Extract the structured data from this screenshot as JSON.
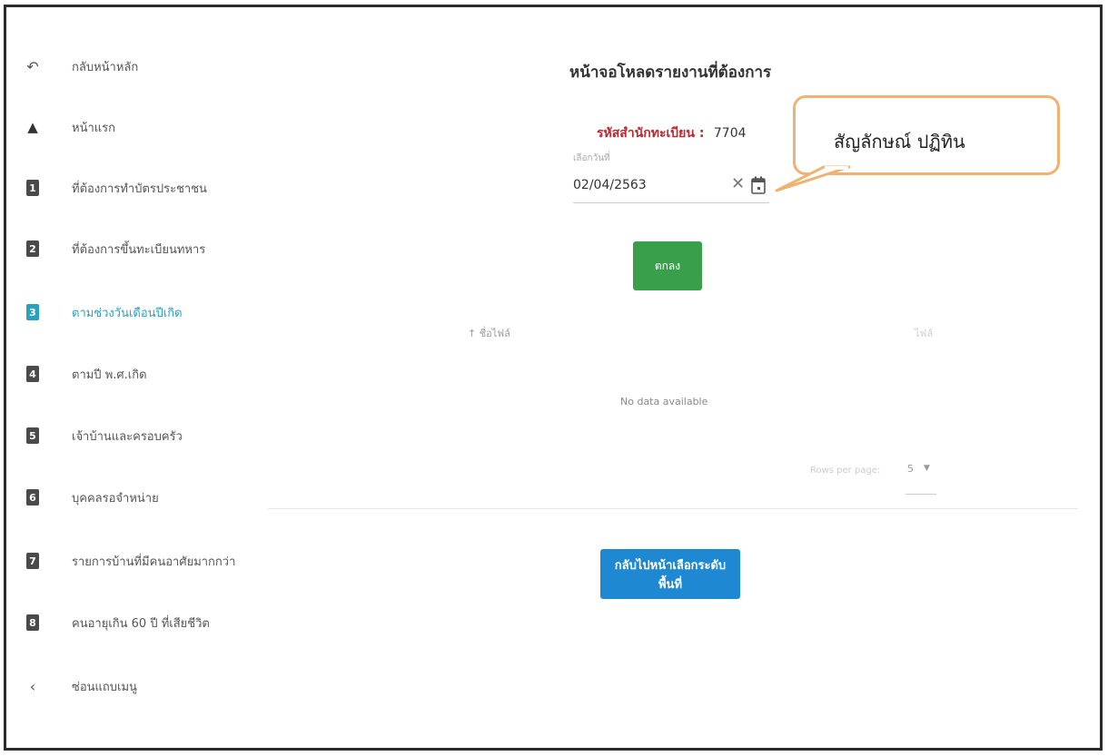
{
  "sidebar": {
    "items": [
      {
        "icon": "↶",
        "icon_name": "undo-icon",
        "label": "กลับหน้าหลัก"
      },
      {
        "icon": "🏠",
        "icon_name": "home-icon",
        "label": "หน้าแรก"
      },
      {
        "icon": "1",
        "icon_name": "number-1-icon",
        "label": "ที่ต้องการทำบัตรประชาชน"
      },
      {
        "icon": "2",
        "icon_name": "number-2-icon",
        "label": "ที่ต้องการขึ้นทะเบียนทหาร"
      },
      {
        "icon": "3",
        "icon_name": "number-3-icon",
        "label": "ตามช่วงวันเดือนปีเกิด"
      },
      {
        "icon": "4",
        "icon_name": "number-4-icon",
        "label": "ตามปี พ.ศ.เกิด"
      },
      {
        "icon": "5",
        "icon_name": "number-5-icon",
        "label": "เจ้าบ้านและครอบครัว"
      },
      {
        "icon": "6",
        "icon_name": "number-6-icon",
        "label": "บุคคลรอจำหน่าย"
      },
      {
        "icon": "7",
        "icon_name": "number-7-icon",
        "label": "รายการบ้านที่มีคนอาศัยมากกว่า"
      },
      {
        "icon": "8",
        "icon_name": "number-8-icon",
        "label": "คนอายุเกิน 60 ปี ที่เสียชีวิต"
      },
      {
        "icon": "‹",
        "icon_name": "chevron-left-icon",
        "label": "ซ่อนแถบเมนู"
      }
    ],
    "active_index": 4
  },
  "main": {
    "title": "หน้าจอโหลดรายงานที่ต้องการ",
    "office_label": "รหัสสำนักทะเบียน :",
    "office_code": "7704",
    "date_caption": "เลือกวันที่",
    "date_value": "02/04/2563",
    "ok_label": "ตกลง",
    "table": {
      "col_file": "↑ ชื่อไฟล์",
      "col_type": "ไฟล์",
      "no_data": "No data available",
      "rows_per_page_label": "Rows per page:",
      "rows_per_page_value": "5"
    },
    "back_label": "กลับไปหน้าเลือกระดับพื้นที่"
  },
  "callout": {
    "text": "สัญลักษณ์ ปฏิทิน"
  },
  "colors": {
    "accent": "#2aa0c0",
    "ok_button": "#3a9f4b",
    "back_button": "#1e88d2",
    "office_label": "#c0282e",
    "callout_border": "#f0b273"
  }
}
